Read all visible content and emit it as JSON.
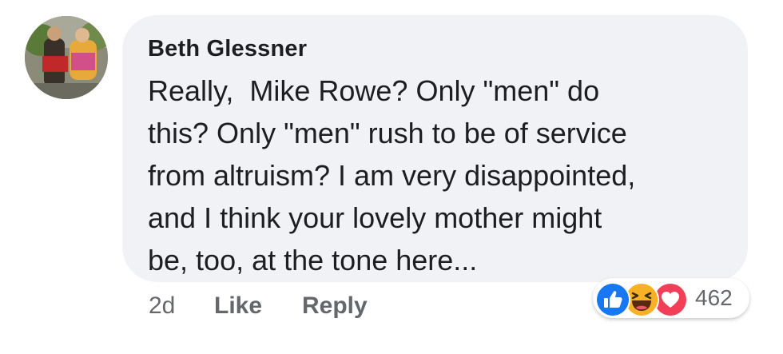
{
  "comment": {
    "author": "Beth Glessner",
    "text": "Really,  Mike Rowe? Only \"men\" do\nthis? Only \"men\" rush to be of service\nfrom altruism? I am very disappointed,\nand I think your lovely mother might\nbe, too, at the tone here...",
    "avatar_icon": "profile-photo"
  },
  "actions": {
    "time": "2d",
    "like_label": "Like",
    "reply_label": "Reply"
  },
  "reactions": {
    "icons": [
      "like-reaction-icon",
      "haha-reaction-icon",
      "love-reaction-icon"
    ],
    "count": "462",
    "colors": {
      "like": "#1877f2",
      "haha": "#f7b125",
      "love": "#f33e58"
    }
  },
  "colors": {
    "bubble": "#f0f2f5",
    "text": "#1c1e21",
    "meta": "#65676b"
  }
}
